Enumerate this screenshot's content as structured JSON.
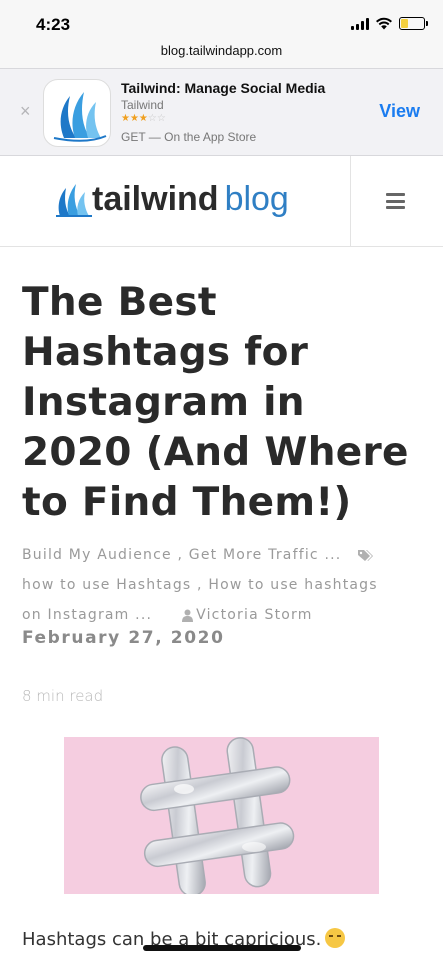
{
  "status_bar": {
    "time": "4:23",
    "battery_level": 0.3
  },
  "url_bar": {
    "url": "blog.tailwindapp.com"
  },
  "app_banner": {
    "close_symbol": "×",
    "title": "Tailwind: Manage Social Media",
    "developer": "Tailwind",
    "stars_filled": "★★★",
    "stars_empty": "☆☆",
    "rating": 3,
    "store_text": "GET — On the App Store",
    "view_label": "View"
  },
  "header": {
    "logo_word_1": "tailwind",
    "logo_word_2": "blog",
    "brand_color": "#2f7fc4"
  },
  "article": {
    "title": "The Best Hashtags for Instagram in 2020 (And Where to Find Them!)",
    "categories": "Build My Audience , Get More Traffic ...",
    "tags_line_1": "how to use Hashtags , How to use hashtags",
    "tags_line_2": "on Instagram ...",
    "author": "Victoria Storm",
    "date": "February 27, 2020",
    "read_time": "8 min read",
    "intro": "Hashtags can be a bit capricious."
  },
  "icons": {
    "close": "close-icon",
    "tag": "tag-icon",
    "author": "user-icon",
    "menu": "hamburger-menu-icon",
    "emoji": "unamused-face-icon"
  }
}
